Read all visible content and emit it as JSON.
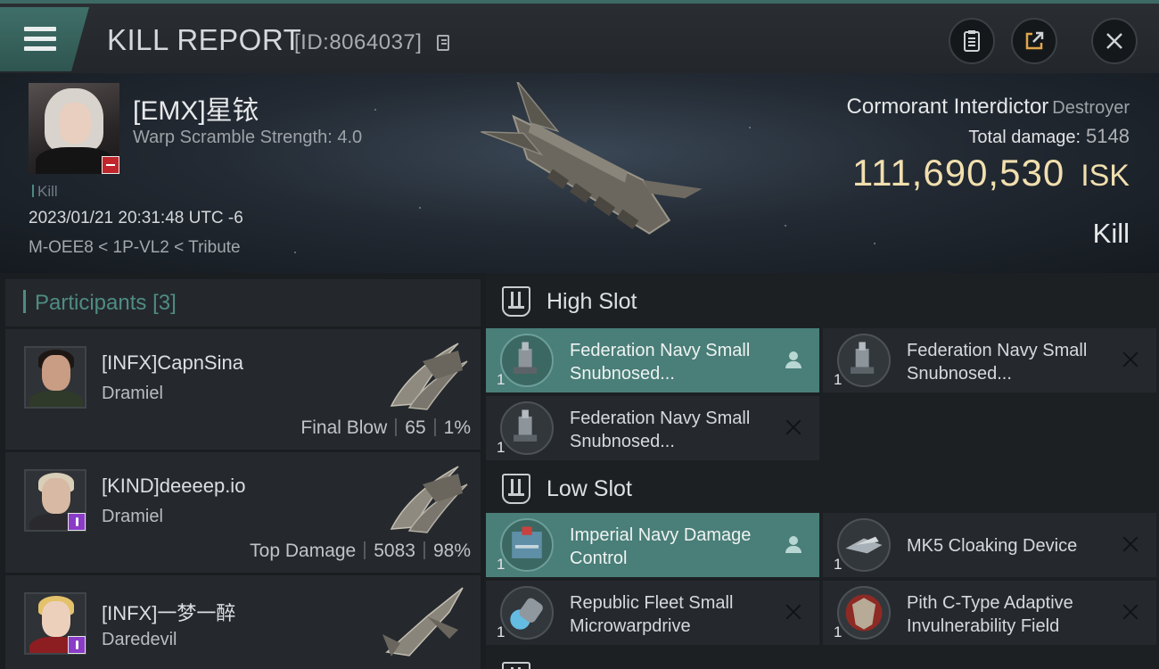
{
  "header": {
    "title": "KILL REPORT",
    "report_id": "[ID:8064037]"
  },
  "victim": {
    "name": "[EMX]星铱",
    "warp_scramble": "Warp Scramble Strength: 4.0",
    "kill_tag": "Kill",
    "timestamp": "2023/01/21 20:31:48 UTC -6",
    "location": "M-OEE8 < 1P-VL2 < Tribute",
    "ship_name": "Cormorant Interdictor",
    "ship_class": "Destroyer",
    "total_damage_label": "Total damage:",
    "total_damage": "5148",
    "isk_value": "111,690,530",
    "isk_unit": "ISK",
    "result": "Kill"
  },
  "participants": {
    "label": "Participants",
    "count": "[3]",
    "items": [
      {
        "name": "[INFX]CapnSina",
        "ship": "Dramiel",
        "role": "Final Blow",
        "damage": "65",
        "percent": "1%"
      },
      {
        "name": "[KIND]deeeep.io",
        "ship": "Dramiel",
        "role": "Top Damage",
        "damage": "5083",
        "percent": "98%"
      },
      {
        "name": "[INFX]一梦一醉",
        "ship": "Daredevil"
      }
    ]
  },
  "slots": {
    "high": {
      "label": "High Slot",
      "modules": [
        {
          "name": "Federation Navy Small Snubnosed...",
          "qty": "1"
        },
        {
          "name": "Federation Navy Small Snubnosed...",
          "qty": "1"
        },
        {
          "name": "Federation Navy Small Snubnosed...",
          "qty": "1"
        }
      ]
    },
    "low": {
      "label": "Low Slot",
      "modules": [
        {
          "name": "Imperial Navy Damage Control",
          "qty": "1"
        },
        {
          "name": "MK5 Cloaking Device",
          "qty": "1"
        },
        {
          "name": "Republic Fleet Small Microwarpdrive",
          "qty": "1"
        },
        {
          "name": "Pith C-Type Adaptive Invulnerability Field",
          "qty": "1"
        }
      ]
    }
  },
  "colors": {
    "accent_teal": "#4a7e78",
    "isk_gold": "#f1dfae",
    "badge_red": "#c0262b",
    "badge_purple": "#8a3cc7"
  }
}
